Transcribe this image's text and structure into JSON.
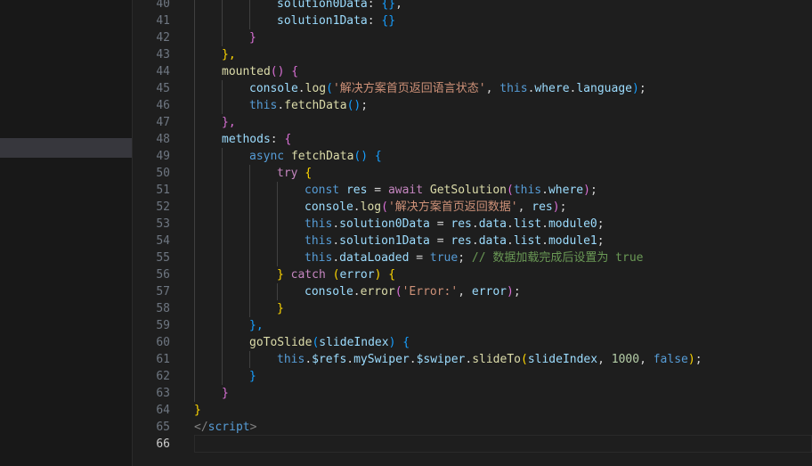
{
  "editor": {
    "language": "javascript (vue)",
    "active_line": "66",
    "lines": [
      {
        "n": "40",
        "indent": 3,
        "tokens": [
          [
            "solution0Data",
            "prop"
          ],
          [
            ": ",
            "plain"
          ],
          [
            "{}",
            "b3"
          ],
          [
            ",",
            "plain"
          ]
        ]
      },
      {
        "n": "41",
        "indent": 3,
        "tokens": [
          [
            "solution1Data",
            "prop"
          ],
          [
            ": ",
            "plain"
          ],
          [
            "{}",
            "b3"
          ]
        ]
      },
      {
        "n": "42",
        "indent": 2,
        "tokens": [
          [
            "}",
            "b2"
          ]
        ]
      },
      {
        "n": "43",
        "indent": 1,
        "tokens": [
          [
            "},",
            "b1"
          ]
        ]
      },
      {
        "n": "44",
        "indent": 1,
        "tokens": [
          [
            "mounted",
            "fn"
          ],
          [
            "()",
            "b2"
          ],
          [
            " ",
            "plain"
          ],
          [
            "{",
            "b2"
          ]
        ]
      },
      {
        "n": "45",
        "indent": 2,
        "tokens": [
          [
            "console",
            "prop"
          ],
          [
            ".",
            "plain"
          ],
          [
            "log",
            "fn"
          ],
          [
            "(",
            "b3"
          ],
          [
            "'解决方案首页返回语言状态'",
            "str"
          ],
          [
            ", ",
            "plain"
          ],
          [
            "this",
            "kw"
          ],
          [
            ".",
            "plain"
          ],
          [
            "where",
            "prop"
          ],
          [
            ".",
            "plain"
          ],
          [
            "language",
            "prop"
          ],
          [
            ")",
            "b3"
          ],
          [
            ";",
            "plain"
          ]
        ]
      },
      {
        "n": "46",
        "indent": 2,
        "tokens": [
          [
            "this",
            "kw"
          ],
          [
            ".",
            "plain"
          ],
          [
            "fetchData",
            "fn"
          ],
          [
            "()",
            "b3"
          ],
          [
            ";",
            "plain"
          ]
        ]
      },
      {
        "n": "47",
        "indent": 1,
        "tokens": [
          [
            "},",
            "b2"
          ]
        ]
      },
      {
        "n": "48",
        "indent": 1,
        "tokens": [
          [
            "methods",
            "prop"
          ],
          [
            ": ",
            "plain"
          ],
          [
            "{",
            "b2"
          ]
        ]
      },
      {
        "n": "49",
        "indent": 2,
        "tokens": [
          [
            "async ",
            "kw"
          ],
          [
            "fetchData",
            "fn"
          ],
          [
            "()",
            "b3"
          ],
          [
            " ",
            "plain"
          ],
          [
            "{",
            "b3"
          ]
        ]
      },
      {
        "n": "50",
        "indent": 3,
        "tokens": [
          [
            "try ",
            "ctrl"
          ],
          [
            "{",
            "b1"
          ]
        ]
      },
      {
        "n": "51",
        "indent": 4,
        "tokens": [
          [
            "const ",
            "kw"
          ],
          [
            "res",
            "prop"
          ],
          [
            " = ",
            "plain"
          ],
          [
            "await ",
            "ctrl"
          ],
          [
            "GetSolution",
            "fn"
          ],
          [
            "(",
            "b2"
          ],
          [
            "this",
            "kw"
          ],
          [
            ".",
            "plain"
          ],
          [
            "where",
            "prop"
          ],
          [
            ")",
            "b2"
          ],
          [
            ";",
            "plain"
          ]
        ]
      },
      {
        "n": "52",
        "indent": 4,
        "tokens": [
          [
            "console",
            "prop"
          ],
          [
            ".",
            "plain"
          ],
          [
            "log",
            "fn"
          ],
          [
            "(",
            "b2"
          ],
          [
            "'解决方案首页返回数据'",
            "str"
          ],
          [
            ", ",
            "plain"
          ],
          [
            "res",
            "prop"
          ],
          [
            ")",
            "b2"
          ],
          [
            ";",
            "plain"
          ]
        ]
      },
      {
        "n": "53",
        "indent": 4,
        "tokens": [
          [
            "this",
            "kw"
          ],
          [
            ".",
            "plain"
          ],
          [
            "solution0Data",
            "prop"
          ],
          [
            " = ",
            "plain"
          ],
          [
            "res",
            "prop"
          ],
          [
            ".",
            "plain"
          ],
          [
            "data",
            "prop"
          ],
          [
            ".",
            "plain"
          ],
          [
            "list",
            "prop"
          ],
          [
            ".",
            "plain"
          ],
          [
            "module0",
            "prop"
          ],
          [
            ";",
            "plain"
          ]
        ]
      },
      {
        "n": "54",
        "indent": 4,
        "tokens": [
          [
            "this",
            "kw"
          ],
          [
            ".",
            "plain"
          ],
          [
            "solution1Data",
            "prop"
          ],
          [
            " = ",
            "plain"
          ],
          [
            "res",
            "prop"
          ],
          [
            ".",
            "plain"
          ],
          [
            "data",
            "prop"
          ],
          [
            ".",
            "plain"
          ],
          [
            "list",
            "prop"
          ],
          [
            ".",
            "plain"
          ],
          [
            "module1",
            "prop"
          ],
          [
            ";",
            "plain"
          ]
        ]
      },
      {
        "n": "55",
        "indent": 4,
        "tokens": [
          [
            "this",
            "kw"
          ],
          [
            ".",
            "plain"
          ],
          [
            "dataLoaded",
            "prop"
          ],
          [
            " = ",
            "plain"
          ],
          [
            "true",
            "kw"
          ],
          [
            "; ",
            "plain"
          ],
          [
            "// 数据加载完成后设置为 true",
            "cmt"
          ]
        ]
      },
      {
        "n": "56",
        "indent": 3,
        "tokens": [
          [
            "}",
            "b1"
          ],
          [
            " catch ",
            "ctrl"
          ],
          [
            "(",
            "b1"
          ],
          [
            "error",
            "prop"
          ],
          [
            ")",
            "b1"
          ],
          [
            " ",
            "plain"
          ],
          [
            "{",
            "b1"
          ]
        ]
      },
      {
        "n": "57",
        "indent": 4,
        "tokens": [
          [
            "console",
            "prop"
          ],
          [
            ".",
            "plain"
          ],
          [
            "error",
            "fn"
          ],
          [
            "(",
            "b2"
          ],
          [
            "'Error:'",
            "str"
          ],
          [
            ", ",
            "plain"
          ],
          [
            "error",
            "prop"
          ],
          [
            ")",
            "b2"
          ],
          [
            ";",
            "plain"
          ]
        ]
      },
      {
        "n": "58",
        "indent": 3,
        "tokens": [
          [
            "}",
            "b1"
          ]
        ]
      },
      {
        "n": "59",
        "indent": 2,
        "tokens": [
          [
            "},",
            "b3"
          ]
        ]
      },
      {
        "n": "60",
        "indent": 2,
        "tokens": [
          [
            "goToSlide",
            "fn"
          ],
          [
            "(",
            "b3"
          ],
          [
            "slideIndex",
            "prop"
          ],
          [
            ")",
            "b3"
          ],
          [
            " ",
            "plain"
          ],
          [
            "{",
            "b3"
          ]
        ]
      },
      {
        "n": "61",
        "indent": 3,
        "tokens": [
          [
            "this",
            "kw"
          ],
          [
            ".",
            "plain"
          ],
          [
            "$refs",
            "prop"
          ],
          [
            ".",
            "plain"
          ],
          [
            "mySwiper",
            "prop"
          ],
          [
            ".",
            "plain"
          ],
          [
            "$swiper",
            "prop"
          ],
          [
            ".",
            "plain"
          ],
          [
            "slideTo",
            "fn"
          ],
          [
            "(",
            "b1"
          ],
          [
            "slideIndex",
            "prop"
          ],
          [
            ", ",
            "plain"
          ],
          [
            "1000",
            "num"
          ],
          [
            ", ",
            "plain"
          ],
          [
            "false",
            "kw"
          ],
          [
            ")",
            "b1"
          ],
          [
            ";",
            "plain"
          ]
        ]
      },
      {
        "n": "62",
        "indent": 2,
        "tokens": [
          [
            "}",
            "b3"
          ]
        ]
      },
      {
        "n": "63",
        "indent": 1,
        "tokens": [
          [
            "}",
            "b2"
          ]
        ]
      },
      {
        "n": "64",
        "indent": 0,
        "tokens": [
          [
            "}",
            "b1"
          ]
        ]
      },
      {
        "n": "65",
        "indent": 0,
        "tokens": [
          [
            "</",
            "tag"
          ],
          [
            "script",
            "kw"
          ],
          [
            ">",
            "tag"
          ]
        ]
      },
      {
        "n": "66",
        "indent": 0,
        "tokens": []
      }
    ]
  }
}
